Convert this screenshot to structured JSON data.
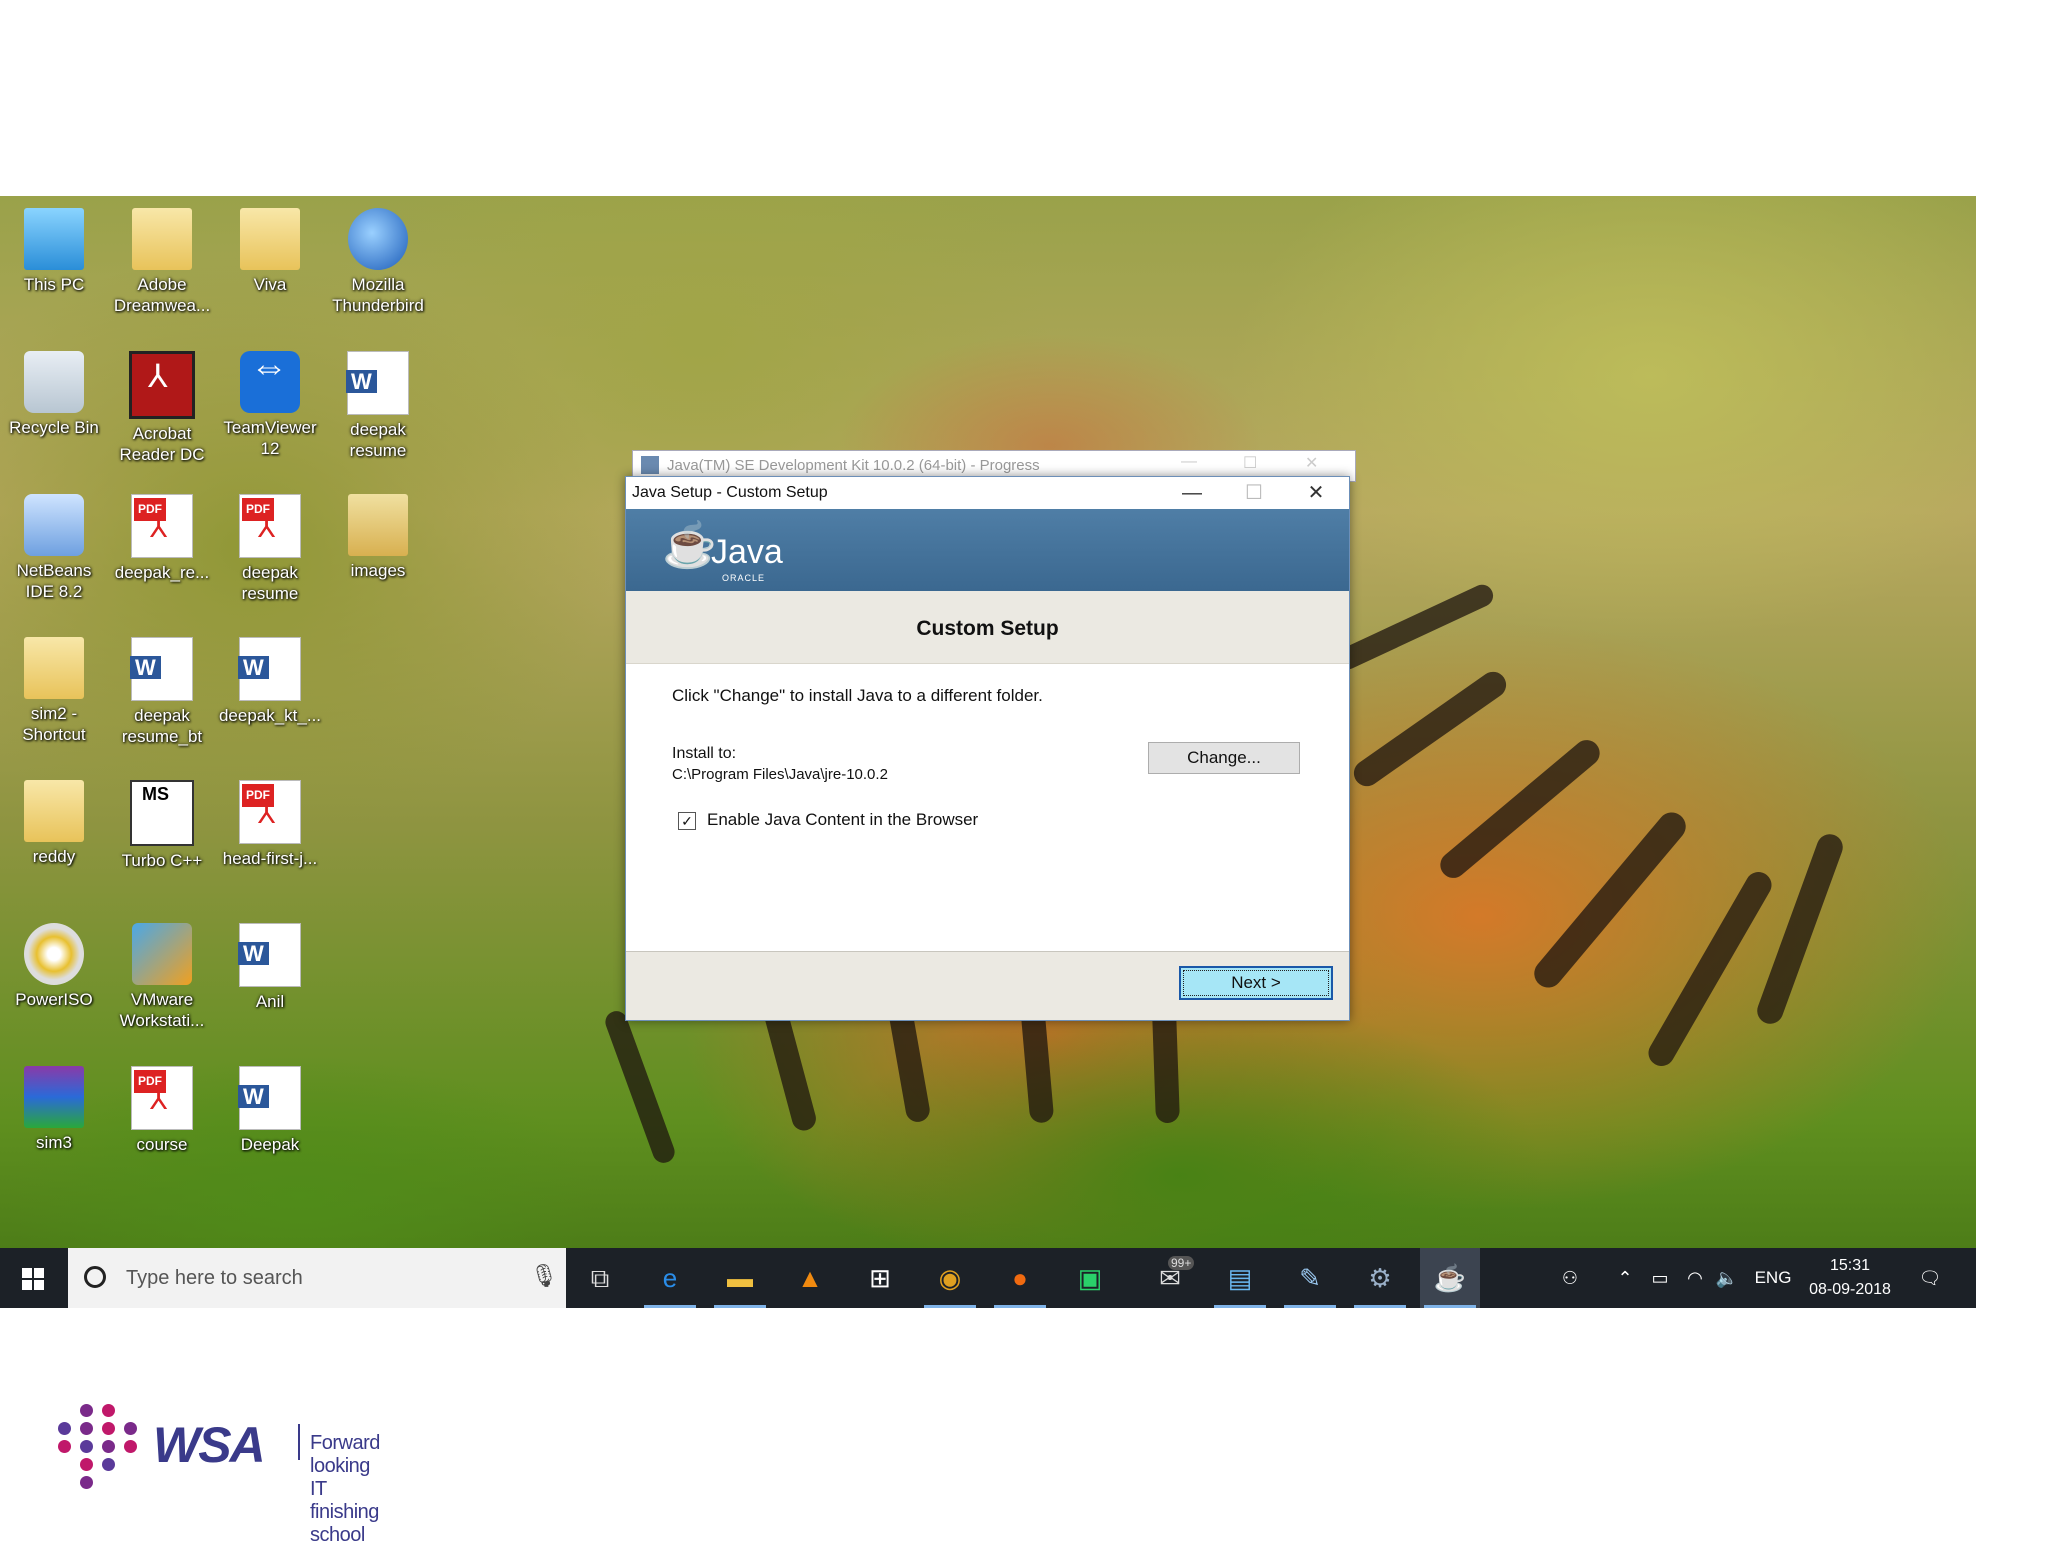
{
  "desktop": {
    "icons": [
      {
        "label": "This PC"
      },
      {
        "label": "Adobe Dreamwea..."
      },
      {
        "label": "Viva"
      },
      {
        "label": "Mozilla Thunderbird"
      },
      {
        "label": "Recycle Bin"
      },
      {
        "label": "Acrobat Reader DC"
      },
      {
        "label": "TeamViewer 12"
      },
      {
        "label": "deepak resume"
      },
      {
        "label": "NetBeans IDE 8.2"
      },
      {
        "label": "deepak_re..."
      },
      {
        "label": "deepak resume"
      },
      {
        "label": "images"
      },
      {
        "label": "sim2 - Shortcut"
      },
      {
        "label": "deepak resume_bt"
      },
      {
        "label": "deepak_kt_..."
      },
      {
        "label": "reddy"
      },
      {
        "label": "Turbo C++"
      },
      {
        "label": "head-first-j..."
      },
      {
        "label": "PowerISO"
      },
      {
        "label": "VMware Workstati..."
      },
      {
        "label": "Anil"
      },
      {
        "label": "sim3"
      },
      {
        "label": "course"
      },
      {
        "label": "Deepak"
      }
    ]
  },
  "progress_window": {
    "title": "Java(TM) SE Development Kit 10.0.2 (64-bit) - Progress"
  },
  "dialog": {
    "title": "Java Setup - Custom Setup",
    "minimize": "—",
    "maximize": "☐",
    "close": "✕",
    "logo_text": "Java",
    "logo_sub": "ORACLE",
    "heading": "Custom Setup",
    "instruction": "Click \"Change\" to install Java to a different folder.",
    "install_label": "Install to:",
    "install_path": "C:\\Program Files\\Java\\jre-10.0.2",
    "change_button": "Change...",
    "checkbox_label": "Enable Java Content in the Browser",
    "checkbox_checked": true,
    "checkbox_mark": "✓",
    "next_button": "Next >"
  },
  "taskbar": {
    "search_placeholder": "Type here to search",
    "mail_badge": "99+",
    "language": "ENG",
    "time": "15:31",
    "date": "08-09-2018"
  },
  "branding": {
    "logo": "WSA",
    "tagline": "Forward looking IT finishing school",
    "dot_colors": [
      "#7a2a8a",
      "#c0186a",
      "#5a3a9a"
    ]
  }
}
